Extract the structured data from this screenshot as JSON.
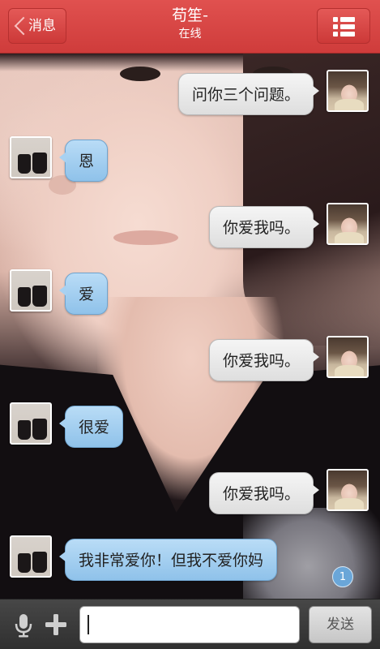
{
  "header": {
    "back_label": "消息",
    "contact_name": "苟笙-",
    "status": "在线",
    "menu_icon": "list-menu-icon"
  },
  "messages": [
    {
      "from": "self",
      "text": "问你三个问题。"
    },
    {
      "from": "other",
      "text": "恩"
    },
    {
      "from": "self",
      "text": "你爱我吗。"
    },
    {
      "from": "other",
      "text": "爱"
    },
    {
      "from": "self",
      "text": "你爱我吗。"
    },
    {
      "from": "other",
      "text": "很爱"
    },
    {
      "from": "self",
      "text": "你爱我吗。"
    },
    {
      "from": "other",
      "text": "我非常爱你！但我不爱你妈"
    }
  ],
  "unread_count": "1",
  "input_bar": {
    "voice_icon": "microphone-icon",
    "more_icon": "plus-icon",
    "input_value": "",
    "send_label": "发送"
  },
  "colors": {
    "header_red": "#d4403f",
    "incoming_bubble": "#a6d0f0",
    "outgoing_bubble": "#ececec",
    "input_bar": "#3a3a3a"
  }
}
